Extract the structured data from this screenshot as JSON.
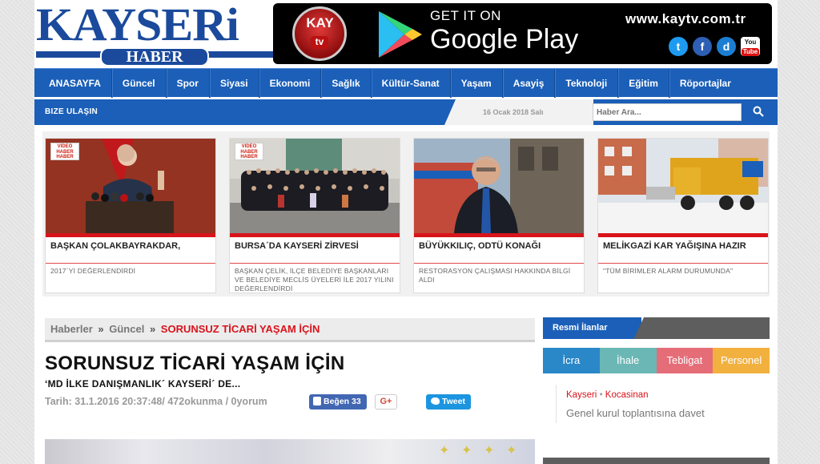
{
  "logo": {
    "top": "KAYSERi",
    "bottom": "HABER"
  },
  "banner": {
    "channel_logo_text": "KAY",
    "channel_logo_sub": "tv",
    "get_it_on": "GET IT ON",
    "store_name": "Google Play",
    "site_url": "www.kaytv.com.tr",
    "social": [
      "twitter-icon",
      "facebook-icon",
      "dailymotion-icon",
      "youtube-icon"
    ]
  },
  "nav": {
    "items": [
      "ANASAYFA",
      "Güncel",
      "Spor",
      "Siyasi",
      "Ekonomi",
      "Sağlık",
      "Kültür-Sanat",
      "Yaşam",
      "Asayiş",
      "Teknoloji",
      "Eğitim",
      "Röportajlar"
    ]
  },
  "subbar": {
    "contact_label": "BIZE ULAŞIN",
    "date": "16 Ocak 2018 Salı",
    "search_placeholder": "Haber Ara..."
  },
  "cards": [
    {
      "title": "BAŞKAN ÇOLAKBAYRAKDAR,",
      "subtitle": "2017´Yİ DEĞERLENDİRDİ",
      "badge": "VIDEO HABER HABER"
    },
    {
      "title": "BURSA´DA KAYSERİ ZİRVESİ",
      "subtitle": "BAŞKAN ÇELİK, İLÇE BELEDİYE BAŞKANLARI VE BELEDİYE MECLİS ÜYELERİ İLE 2017 YILINI DEĞERLENDİRDİ",
      "badge": "VIDEO HABER HABER"
    },
    {
      "title": "BÜYÜKKILIÇ, ODTÜ KONAĞI",
      "subtitle": "RESTORASYON ÇALIŞMASI HAKKINDA BİLGİ ALDI",
      "badge": ""
    },
    {
      "title": "MELİKGAZİ KAR YAĞIŞINA HAZIR",
      "subtitle": "\"TÜM BİRİMLER ALARM DURUMUNDA\"",
      "badge": ""
    }
  ],
  "breadcrumb": {
    "root": "Haberler",
    "section": "Güncel",
    "current": "SORUNSUZ TİCARİ YAŞAM İÇİN",
    "sep": "»"
  },
  "article": {
    "title": "SORUNSUZ TİCARİ YAŞAM İÇİN",
    "subtitle": "‘MD İLKE DANIŞMANLIK´ KAYSERİ´ DE...",
    "meta": "Tarih: 31.1.2016 20:37:48/ 472okunma / 0yorum",
    "like_label": "Beğen 33",
    "gplus_label": "G+",
    "tweet_label": "Tweet"
  },
  "sidebar": {
    "header": "Resmi İlanlar",
    "tabs": [
      "İcra",
      "İhale",
      "Tebligat",
      "Personel"
    ],
    "item_city": "Kayseri",
    "item_sep": "•",
    "item_district": "Kocasinan",
    "item_title": "Genel kurul toplantısına davet"
  },
  "colors": {
    "brand": "#1b5fb8",
    "accent": "#d8141b"
  }
}
